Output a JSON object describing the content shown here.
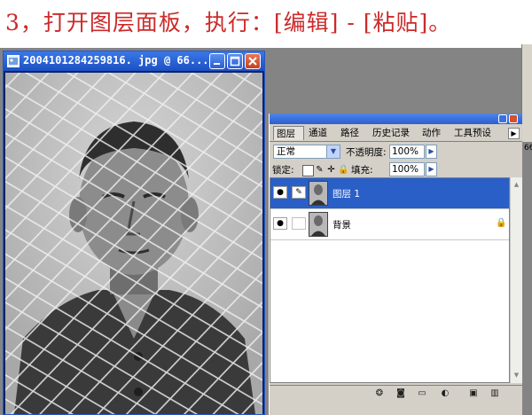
{
  "instruction": {
    "text": "3，打开图层面板，执行：[编辑] - [粘贴]。",
    "color": "#cc2a2a"
  },
  "document_window": {
    "title": "2004101284259816. jpg @ 66...",
    "icons": [
      "photoshop-doc-icon",
      "minimize-icon",
      "maximize-icon",
      "close-icon"
    ]
  },
  "right_panel_fragment": {
    "zoom_text": "66"
  },
  "layers_palette": {
    "tabs": [
      {
        "label": "图层",
        "active": true
      },
      {
        "label": "通道",
        "active": false
      },
      {
        "label": "路径",
        "active": false
      },
      {
        "label": "历史记录",
        "active": false
      },
      {
        "label": "动作",
        "active": false
      },
      {
        "label": "工具预设",
        "active": false
      }
    ],
    "blend_mode": "正常",
    "opacity_label": "不透明度:",
    "opacity_value": "100%",
    "lock_label": "锁定:",
    "fill_label": "填充:",
    "fill_value": "100%",
    "layers": [
      {
        "name": "图层 1",
        "visible": true,
        "selected": true,
        "locked": false
      },
      {
        "name": "背景",
        "visible": true,
        "selected": false,
        "locked": true
      }
    ],
    "bottom_icons": [
      "layer-style-icon",
      "layer-mask-icon",
      "new-group-icon",
      "adjustment-layer-icon",
      "new-layer-icon",
      "delete-layer-icon"
    ],
    "accent_color": "#2a5fc7"
  }
}
